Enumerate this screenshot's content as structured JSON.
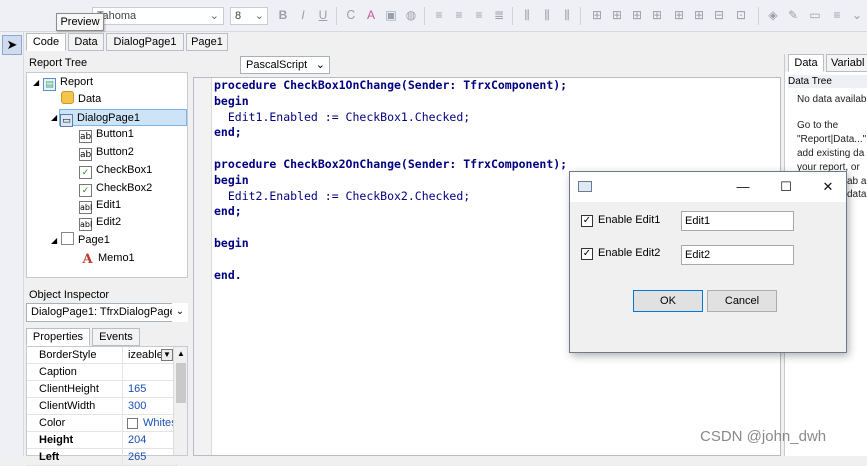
{
  "toolbar": {
    "font_name": "Tahoma",
    "font_size": "8",
    "tooltip": "Preview"
  },
  "tabs": [
    "Code",
    "Data",
    "DialogPage1",
    "Page1"
  ],
  "report_tree": {
    "title": "Report Tree",
    "nodes": [
      {
        "label": "Report",
        "icon": "report-icon"
      },
      {
        "label": "Data",
        "icon": "data-icon"
      },
      {
        "label": "DialogPage1",
        "icon": "dialog-icon"
      },
      {
        "label": "Button1",
        "icon": "button-icon",
        "glyph": "ab"
      },
      {
        "label": "Button2",
        "icon": "button-icon",
        "glyph": "ab"
      },
      {
        "label": "CheckBox1",
        "icon": "checkbox-icon",
        "glyph": "✓"
      },
      {
        "label": "CheckBox2",
        "icon": "checkbox-icon",
        "glyph": "✓"
      },
      {
        "label": "Edit1",
        "icon": "edit-icon",
        "glyph": "abl"
      },
      {
        "label": "Edit2",
        "icon": "edit-icon",
        "glyph": "abl"
      },
      {
        "label": "Page1",
        "icon": "page-icon"
      },
      {
        "label": "Memo1",
        "icon": "memo-icon",
        "glyph": "A"
      }
    ]
  },
  "object_inspector": {
    "title": "Object Inspector",
    "selected": "DialogPage1: TfrxDialogPage",
    "tabs": [
      "Properties",
      "Events"
    ],
    "rows": [
      {
        "name": "BorderStyle",
        "value": "izeable"
      },
      {
        "name": "Caption",
        "value": ""
      },
      {
        "name": "ClientHeight",
        "value": "165"
      },
      {
        "name": "ClientWidth",
        "value": "300"
      },
      {
        "name": "Color",
        "value": "Whites"
      },
      {
        "name": "Height",
        "value": "204"
      },
      {
        "name": "Left",
        "value": "265"
      }
    ]
  },
  "editor": {
    "language": "PascalScript",
    "lines": [
      "procedure CheckBox1OnChange(Sender: TfrxComponent);",
      "begin",
      "  Edit1.Enabled := CheckBox1.Checked;",
      "end;",
      "",
      "procedure CheckBox2OnChange(Sender: TfrxComponent);",
      "begin",
      "  Edit2.Enabled := CheckBox2.Checked;",
      "end;",
      "",
      "begin",
      "",
      "end."
    ]
  },
  "right_panel": {
    "tabs": [
      "Data",
      "Variabl"
    ],
    "title": "Data Tree",
    "lines": [
      "No data availab",
      "",
      "Go to the",
      "\"Report|Data...\"",
      "add existing da",
      "your report, or",
      "ab a",
      "data"
    ]
  },
  "dialog": {
    "checkbox1_label": "Enable Edit1",
    "checkbox2_label": "Enable Edit2",
    "edit1_value": "Edit1",
    "edit2_value": "Edit2",
    "ok_label": "OK",
    "cancel_label": "Cancel",
    "minimize": "—",
    "maximize": "☐",
    "close": "✕"
  },
  "watermark": "CSDN @john_dwh"
}
